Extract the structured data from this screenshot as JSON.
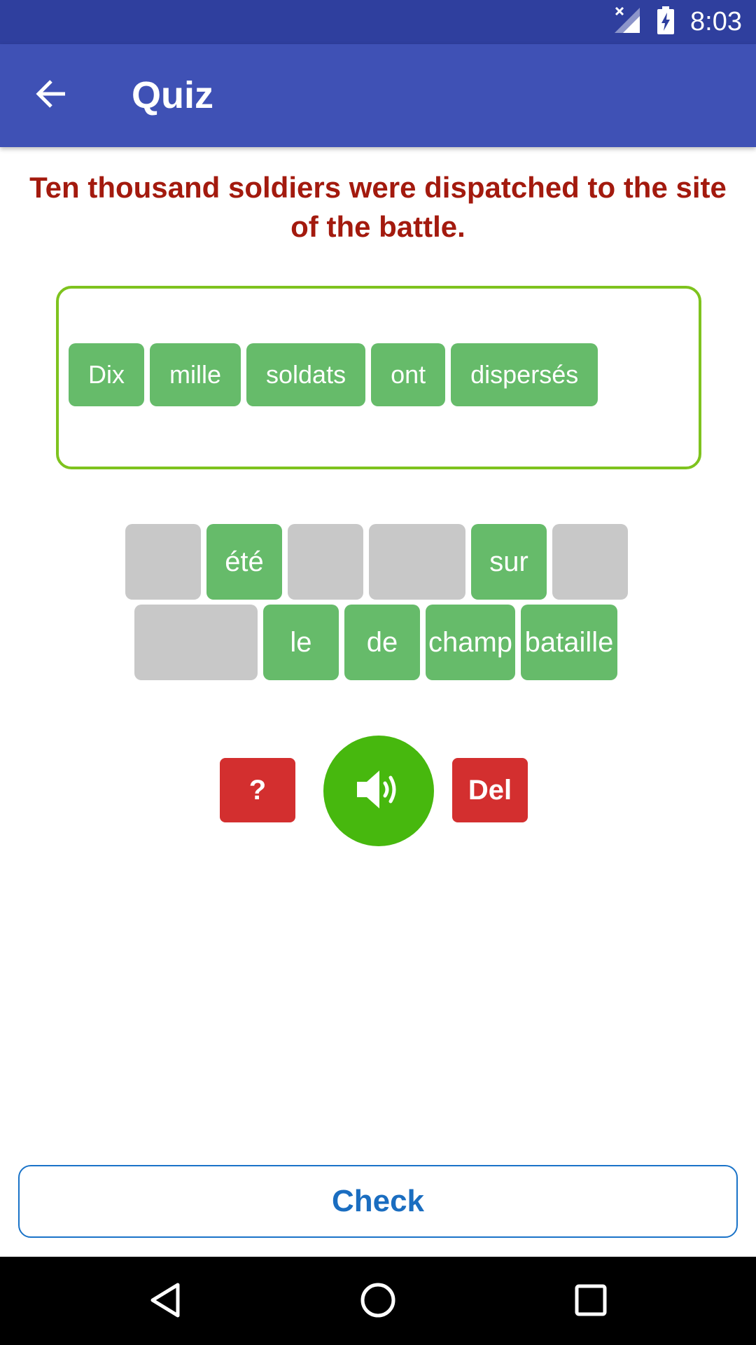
{
  "status_bar": {
    "time": "8:03",
    "icons": [
      "signal-off-icon",
      "battery-charging-icon"
    ]
  },
  "app_bar": {
    "back_icon": "arrow-left-icon",
    "title": "Quiz"
  },
  "prompt": {
    "text": "Ten thousand soldiers were dispatched to the site of the battle."
  },
  "answer": {
    "words": [
      "Dix",
      "mille",
      "soldats",
      "ont",
      "dispersés"
    ]
  },
  "word_bank": {
    "row1": [
      {
        "label": "",
        "used": true
      },
      {
        "label": "été",
        "used": false
      },
      {
        "label": "",
        "used": true
      },
      {
        "label": "",
        "used": true
      },
      {
        "label": "sur",
        "used": false
      },
      {
        "label": "",
        "used": true
      }
    ],
    "row2": [
      {
        "label": "",
        "used": true
      },
      {
        "label": "le",
        "used": false
      },
      {
        "label": "de",
        "used": false
      },
      {
        "label": "champ",
        "used": false
      },
      {
        "label": "bataille",
        "used": false
      }
    ]
  },
  "controls": {
    "hint_label": "?",
    "speaker_icon": "speaker-icon",
    "del_label": "Del"
  },
  "check": {
    "label": "Check"
  },
  "nav_bar": {
    "icons": [
      "nav-back-icon",
      "nav-home-icon",
      "nav-recent-icon"
    ]
  },
  "colors": {
    "status_bar": "#2f3f9e",
    "app_bar": "#3f51b5",
    "prompt_text": "#a31a0e",
    "answer_border": "#7ec31e",
    "chip_green": "#66bb6a",
    "tile_used": "#c8c8c8",
    "danger_red": "#d32f2f",
    "speaker_green": "#47b80e",
    "check_blue": "#1a6dc0"
  }
}
